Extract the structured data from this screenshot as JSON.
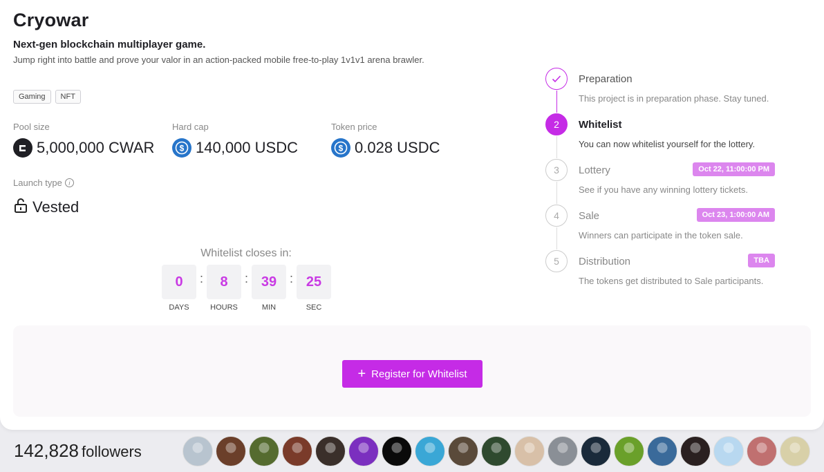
{
  "project": {
    "title": "Cryowar",
    "subtitle": "Next-gen blockchain multiplayer game.",
    "description": "Jump right into battle and prove your valor in an action-packed mobile free-to-play 1v1v1 arena brawler.",
    "tags": [
      "Gaming",
      "NFT"
    ]
  },
  "stats": {
    "pool_size": {
      "label": "Pool size",
      "value": "5,000,000 CWAR",
      "icon": "cwar-coin-icon"
    },
    "hard_cap": {
      "label": "Hard cap",
      "value": "140,000 USDC",
      "icon": "usdc-coin-icon"
    },
    "token_price": {
      "label": "Token price",
      "value": "0.028 USDC",
      "icon": "usdc-coin-icon"
    }
  },
  "launch": {
    "label": "Launch type",
    "value": "Vested",
    "icon": "unlock-icon"
  },
  "countdown": {
    "label": "Whitelist closes in:",
    "units": [
      {
        "value": "0",
        "name": "DAYS"
      },
      {
        "value": "8",
        "name": "HOURS"
      },
      {
        "value": "39",
        "name": "MIN"
      },
      {
        "value": "25",
        "name": "SEC"
      }
    ]
  },
  "cta": {
    "label": "Register for Whitelist",
    "icon": "plus-icon"
  },
  "steps": [
    {
      "number": "",
      "title": "Preparation",
      "desc": "This project is in preparation phase. Stay tuned.",
      "status": "done",
      "date": ""
    },
    {
      "number": "2",
      "title": "Whitelist",
      "desc": "You can now whitelist yourself for the lottery.",
      "status": "active",
      "date": ""
    },
    {
      "number": "3",
      "title": "Lottery",
      "desc": "See if you have any winning lottery tickets.",
      "status": "pending",
      "date": "Oct 22, 11:00:00 PM"
    },
    {
      "number": "4",
      "title": "Sale",
      "desc": "Winners can participate in the token sale.",
      "status": "pending",
      "date": "Oct 23, 1:00:00 AM"
    },
    {
      "number": "5",
      "title": "Distribution",
      "desc": "The tokens get distributed to Sale participants.",
      "status": "pending",
      "date": "TBA"
    }
  ],
  "followers": {
    "count": "142,828",
    "label": "followers"
  },
  "avatar_colors": [
    "#b8c4cf",
    "#6b3f2a",
    "#556b2f",
    "#7a3b2a",
    "#3a2f2a",
    "#7b2fbf",
    "#0a0a0a",
    "#3aa7d6",
    "#5a4a3a",
    "#2f4a2f",
    "#d8c0a8",
    "#8a8f96",
    "#1a2a3a",
    "#6aa02a",
    "#3a6a9a",
    "#2a2020",
    "#b8d8f0",
    "#c07070",
    "#d8d0a8"
  ],
  "colors": {
    "accent": "#c52be6",
    "accent_light": "#dc86ee",
    "usdc": "#2775ca"
  }
}
